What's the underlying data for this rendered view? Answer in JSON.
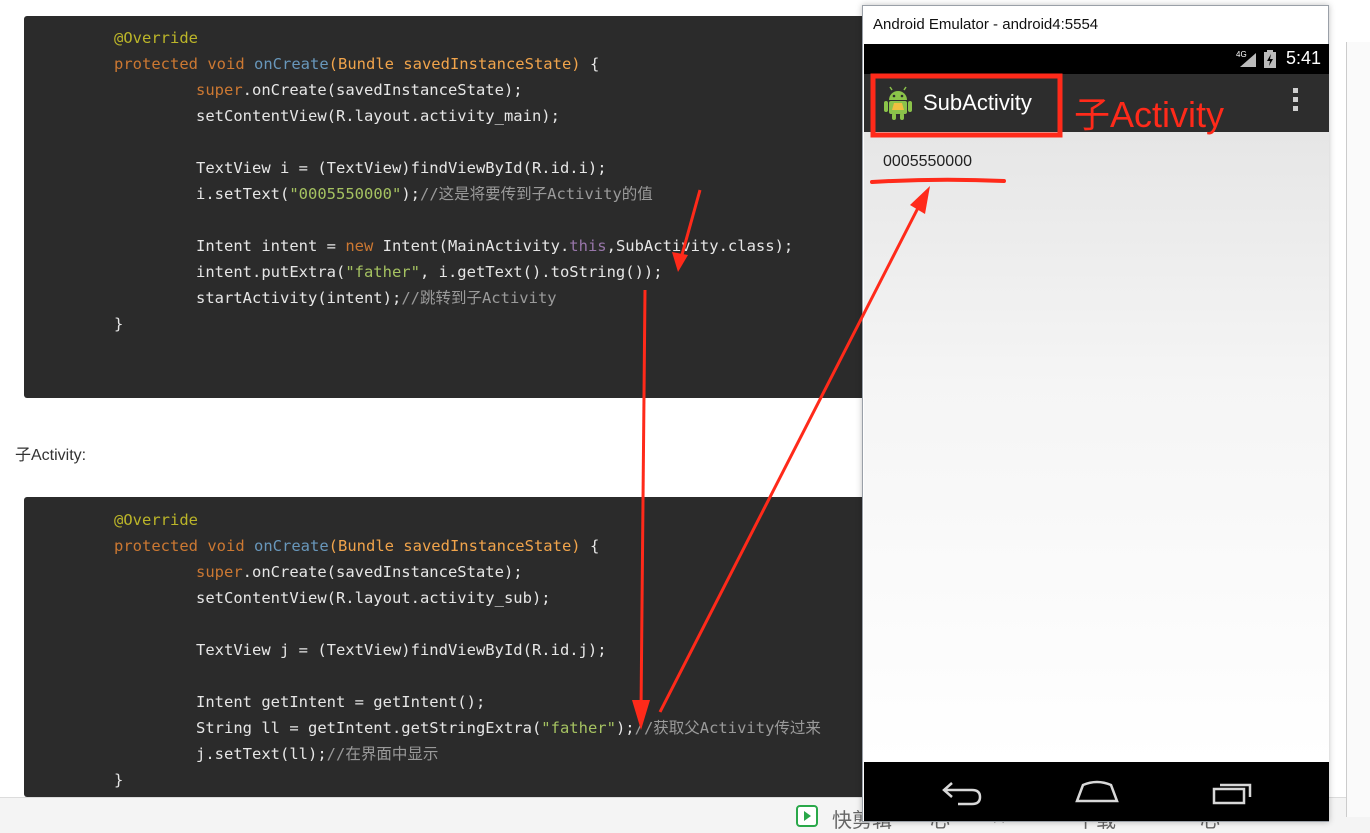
{
  "code_block_1": {
    "lines": [
      [
        {
          "t": "@Override",
          "c": "ann"
        }
      ],
      [
        {
          "t": "protected",
          "c": "kw"
        },
        {
          "t": " void ",
          "c": "kw"
        },
        {
          "t": "onCreate",
          "c": "fn"
        },
        {
          "t": "(Bundle savedInstanceState)",
          "c": "cls"
        },
        {
          "t": " {",
          "c": "plain"
        }
      ],
      [
        {
          "t": "super",
          "c": "kw"
        },
        {
          "t": ".onCreate(savedInstanceState);",
          "c": "plain"
        }
      ],
      [
        {
          "t": "setContentView(R.layout.activity_main);",
          "c": "plain"
        }
      ],
      [],
      [
        {
          "t": "TextView i = (TextView)findViewById(R.id.i);",
          "c": "plain"
        }
      ],
      [
        {
          "t": "i.setText(",
          "c": "plain"
        },
        {
          "t": "\"0005550000\"",
          "c": "str"
        },
        {
          "t": ");",
          "c": "plain"
        },
        {
          "t": "//这是将要传到子Activity的值",
          "c": "cmt"
        }
      ],
      [],
      [
        {
          "t": "Intent intent = ",
          "c": "plain"
        },
        {
          "t": "new",
          "c": "kw"
        },
        {
          "t": " Intent(MainActivity.",
          "c": "plain"
        },
        {
          "t": "this",
          "c": "spec"
        },
        {
          "t": ",SubActivity.class);",
          "c": "plain"
        }
      ],
      [
        {
          "t": "intent.putExtra(",
          "c": "plain"
        },
        {
          "t": "\"father\"",
          "c": "str"
        },
        {
          "t": ", i.getText().toString());",
          "c": "plain"
        }
      ],
      [
        {
          "t": "startActivity(intent);",
          "c": "plain"
        },
        {
          "t": "//跳转到子Activity",
          "c": "cmt"
        }
      ],
      [
        {
          "t": "}",
          "c": "plain"
        }
      ]
    ]
  },
  "section_label": "子Activity:",
  "code_block_2": {
    "lines": [
      [
        {
          "t": "@Override",
          "c": "ann"
        }
      ],
      [
        {
          "t": "protected",
          "c": "kw"
        },
        {
          "t": " void ",
          "c": "kw"
        },
        {
          "t": "onCreate",
          "c": "fn"
        },
        {
          "t": "(Bundle savedInstanceState)",
          "c": "cls"
        },
        {
          "t": " {",
          "c": "plain"
        }
      ],
      [
        {
          "t": "super",
          "c": "kw"
        },
        {
          "t": ".onCreate(savedInstanceState);",
          "c": "plain"
        }
      ],
      [
        {
          "t": "setContentView(R.layout.activity_sub);",
          "c": "plain"
        }
      ],
      [],
      [
        {
          "t": "TextView j = (TextView)findViewById(R.id.j);",
          "c": "plain"
        }
      ],
      [],
      [
        {
          "t": "Intent getIntent = getIntent();",
          "c": "plain"
        }
      ],
      [
        {
          "t": "String ll = getIntent.getStringExtra(",
          "c": "plain"
        },
        {
          "t": "\"father\"",
          "c": "str"
        },
        {
          "t": ");",
          "c": "plain"
        },
        {
          "t": "//获取父Activity传过来",
          "c": "cmt"
        }
      ],
      [
        {
          "t": "j.setText(ll);",
          "c": "plain"
        },
        {
          "t": "//在界面中显示",
          "c": "cmt"
        }
      ],
      [
        {
          "t": "}",
          "c": "plain"
        }
      ]
    ]
  },
  "emulator": {
    "window_title": "Android Emulator - android4:5554",
    "status_time": "5:41",
    "signal_label": "4G",
    "app_title": "SubActivity",
    "value_text": "0005550000"
  },
  "annotation_label": "子Activity",
  "bottom_bar": {
    "items": [
      "快剪辑",
      "心",
      "☆",
      "下载",
      "心"
    ]
  },
  "colors": {
    "annotation_red": "#ff2a1a",
    "code_background": "#2b2b2b",
    "actionbar": "#2d2d2d"
  }
}
